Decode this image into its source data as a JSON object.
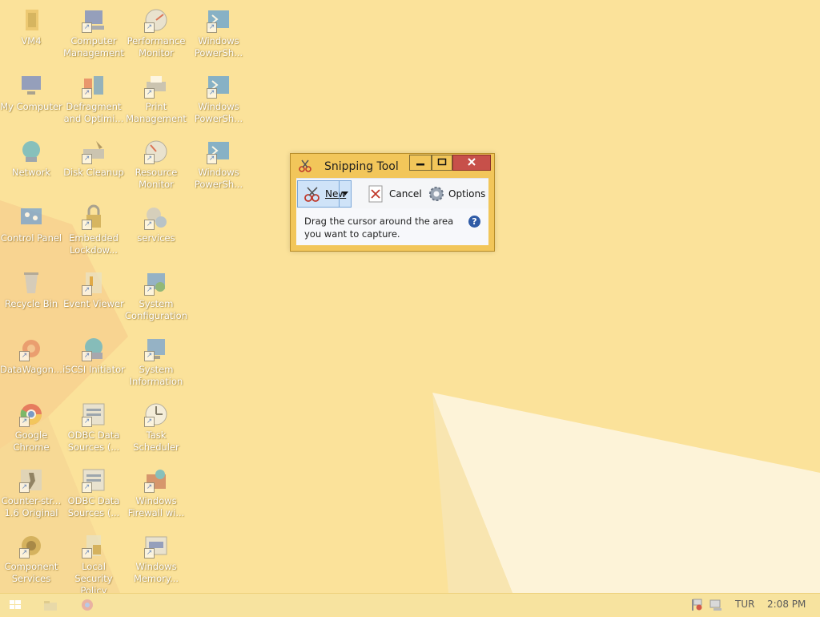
{
  "desktop": {
    "icons": [
      {
        "label": "VM4",
        "icon": "folder-icon"
      },
      {
        "label": "Computer Management",
        "icon": "computer-management-icon"
      },
      {
        "label": "Performance Monitor",
        "icon": "performance-monitor-icon"
      },
      {
        "label": "Windows PowerSh...",
        "icon": "powershell-icon"
      },
      {
        "label": "My Computer",
        "icon": "my-computer-icon"
      },
      {
        "label": "Defragment and Optimi...",
        "icon": "defragment-icon"
      },
      {
        "label": "Print Management",
        "icon": "print-management-icon"
      },
      {
        "label": "Windows PowerSh...",
        "icon": "powershell-icon"
      },
      {
        "label": "Network",
        "icon": "network-icon"
      },
      {
        "label": "Disk Cleanup",
        "icon": "disk-cleanup-icon"
      },
      {
        "label": "Resource Monitor",
        "icon": "resource-monitor-icon"
      },
      {
        "label": "Windows PowerSh...",
        "icon": "powershell-icon"
      },
      {
        "label": "Control Panel",
        "icon": "control-panel-icon"
      },
      {
        "label": "Embedded Lockdow...",
        "icon": "embedded-lockdown-icon"
      },
      {
        "label": "services",
        "icon": "services-icon"
      },
      {
        "label": "Recycle Bin",
        "icon": "recycle-bin-icon"
      },
      {
        "label": "Event Viewer",
        "icon": "event-viewer-icon"
      },
      {
        "label": "System Configuration",
        "icon": "system-configuration-icon"
      },
      {
        "label": "DataWagon...",
        "icon": "datawagon-icon"
      },
      {
        "label": "iSCSI Initiator",
        "icon": "iscsi-initiator-icon"
      },
      {
        "label": "System Information",
        "icon": "system-information-icon"
      },
      {
        "label": "Google Chrome",
        "icon": "chrome-icon"
      },
      {
        "label": "ODBC Data Sources (...",
        "icon": "odbc-icon"
      },
      {
        "label": "Task Scheduler",
        "icon": "task-scheduler-icon"
      },
      {
        "label": "Counter-str... 1.6 Original",
        "icon": "counter-strike-icon"
      },
      {
        "label": "ODBC Data Sources (...",
        "icon": "odbc-icon"
      },
      {
        "label": "Windows Firewall wi...",
        "icon": "firewall-icon"
      },
      {
        "label": "Component Services",
        "icon": "component-services-icon"
      },
      {
        "label": "Local Security Policy",
        "icon": "local-security-policy-icon"
      },
      {
        "label": "Windows Memory...",
        "icon": "windows-memory-icon"
      }
    ]
  },
  "snipping_tool": {
    "title": "Snipping Tool",
    "new_label": "New",
    "cancel_label": "Cancel",
    "options_label": "Options",
    "message": "Drag the cursor around the area you want to capture.",
    "help_glyph": "?"
  },
  "taskbar": {
    "language": "TUR",
    "time": "2:08 PM"
  },
  "colors": {
    "wallpaper": "#fbe29a",
    "window_frame": "#f2c65a",
    "close_button": "#c7504a",
    "new_button": "#cfe3f8"
  }
}
